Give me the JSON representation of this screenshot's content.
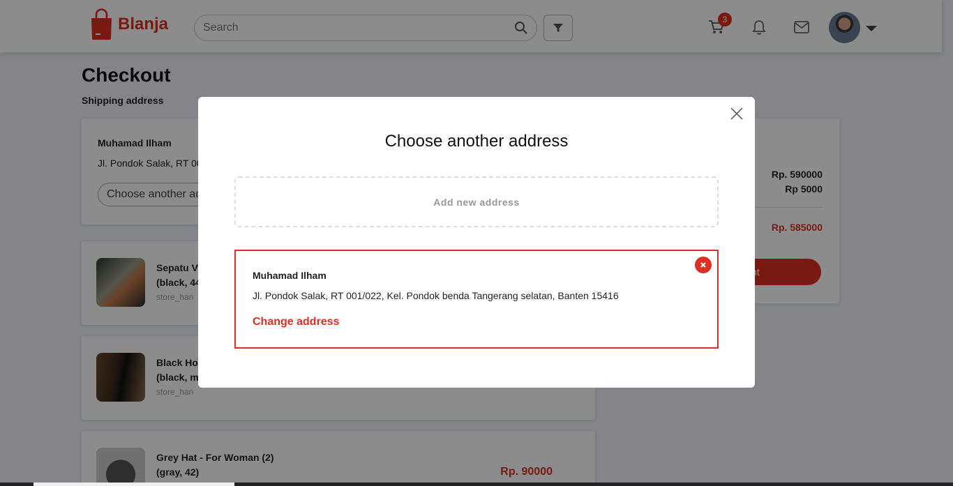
{
  "brand": {
    "name": "Blanja",
    "accent": "#db3022"
  },
  "navbar": {
    "search_placeholder": "Search",
    "cart_count": "3",
    "icons": [
      "search-icon",
      "filter-icon",
      "cart-icon",
      "bell-icon",
      "mail-icon",
      "chevron-down-icon"
    ]
  },
  "page": {
    "title": "Checkout",
    "shipping_label": "Shipping address",
    "address": {
      "name": "Muhamad Ilham",
      "text": "Jl. Pondok Salak, RT 00",
      "choose_button": "Choose another ad"
    },
    "products": [
      {
        "name": "Sepatu V\n(black, 44",
        "store": "store_han",
        "price": ""
      },
      {
        "name": "Black Ho\n(black, m",
        "store": "store_han",
        "price": ""
      },
      {
        "name": "Grey Hat - For Woman (2)\n(gray, 42)",
        "store": "",
        "price": "Rp. 90000"
      }
    ],
    "summary": {
      "order_value": "Rp. 590000",
      "delivery_value": "Rp 5000",
      "total_value": "Rp. 585000",
      "buy_button": "nt"
    }
  },
  "modal": {
    "title": "Choose another address",
    "add_new": "Add new address",
    "selected_address": {
      "name": "Muhamad Ilham",
      "text": "Jl. Pondok Salak, RT 001/022, Kel. Pondok benda Tangerang selatan, Banten 15416",
      "change_link": "Change address"
    }
  }
}
